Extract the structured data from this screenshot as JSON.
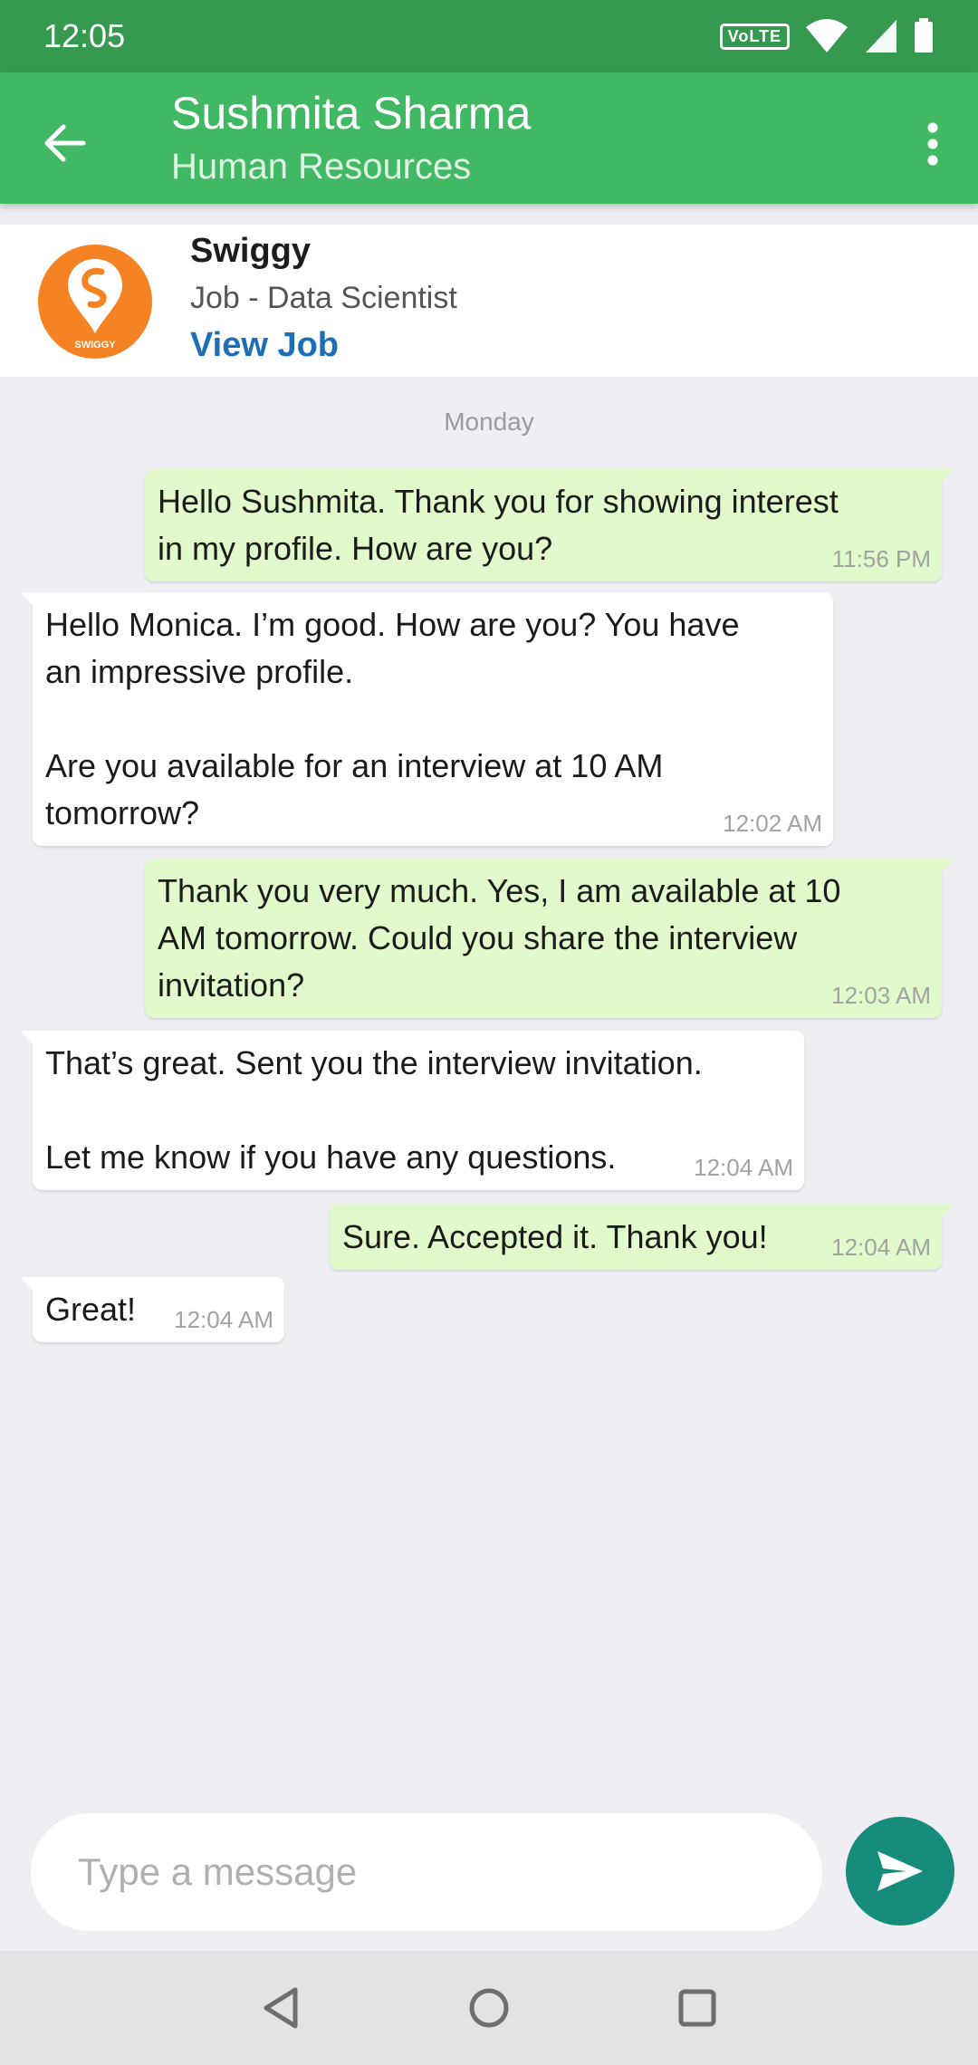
{
  "status_bar": {
    "time": "12:05",
    "volte": "VoLTE"
  },
  "header": {
    "name": "Sushmita Sharma",
    "role": "Human Resources"
  },
  "job": {
    "logo_text": "SWIGGY",
    "company": "Swiggy",
    "title": "Job - Data Scientist",
    "link": "View Job"
  },
  "day_label": "Monday",
  "messages": [
    {
      "dir": "out",
      "text": "Hello Sushmita. Thank you for showing interest\nin my profile. How are you?",
      "time": "11:56 PM"
    },
    {
      "dir": "in",
      "text": "Hello Monica. I’m good. How are you? You have\nan impressive profile.\n\nAre you available for an interview at 10 AM\ntomorrow?",
      "time": "12:02 AM"
    },
    {
      "dir": "out",
      "text": "Thank you very much. Yes, I am available at 10\nAM tomorrow. Could you share the interview\ninvitation?",
      "time": "12:03 AM"
    },
    {
      "dir": "in",
      "text": "That’s great. Sent you the interview invitation.\n\nLet me know if you have any questions.",
      "time": "12:04 AM"
    },
    {
      "dir": "out",
      "text": "Sure. Accepted it. Thank you!",
      "time": "12:04 AM"
    },
    {
      "dir": "in",
      "text": "Great!",
      "time": "12:04 AM"
    }
  ],
  "composer": {
    "placeholder": "Type a message"
  },
  "colors": {
    "status_bar": "#35994f",
    "app_bar": "#41b863",
    "outgoing_bubble": "#e2f9cc",
    "incoming_bubble": "#ffffff",
    "send_button": "#168c7d",
    "link": "#1d6eb6",
    "brand_logo": "#f58323"
  },
  "icons": [
    "back-arrow-icon",
    "more-vert-icon",
    "send-icon",
    "nav-back-icon",
    "nav-home-icon",
    "nav-recents-icon",
    "wifi-icon",
    "signal-icon",
    "battery-icon"
  ]
}
